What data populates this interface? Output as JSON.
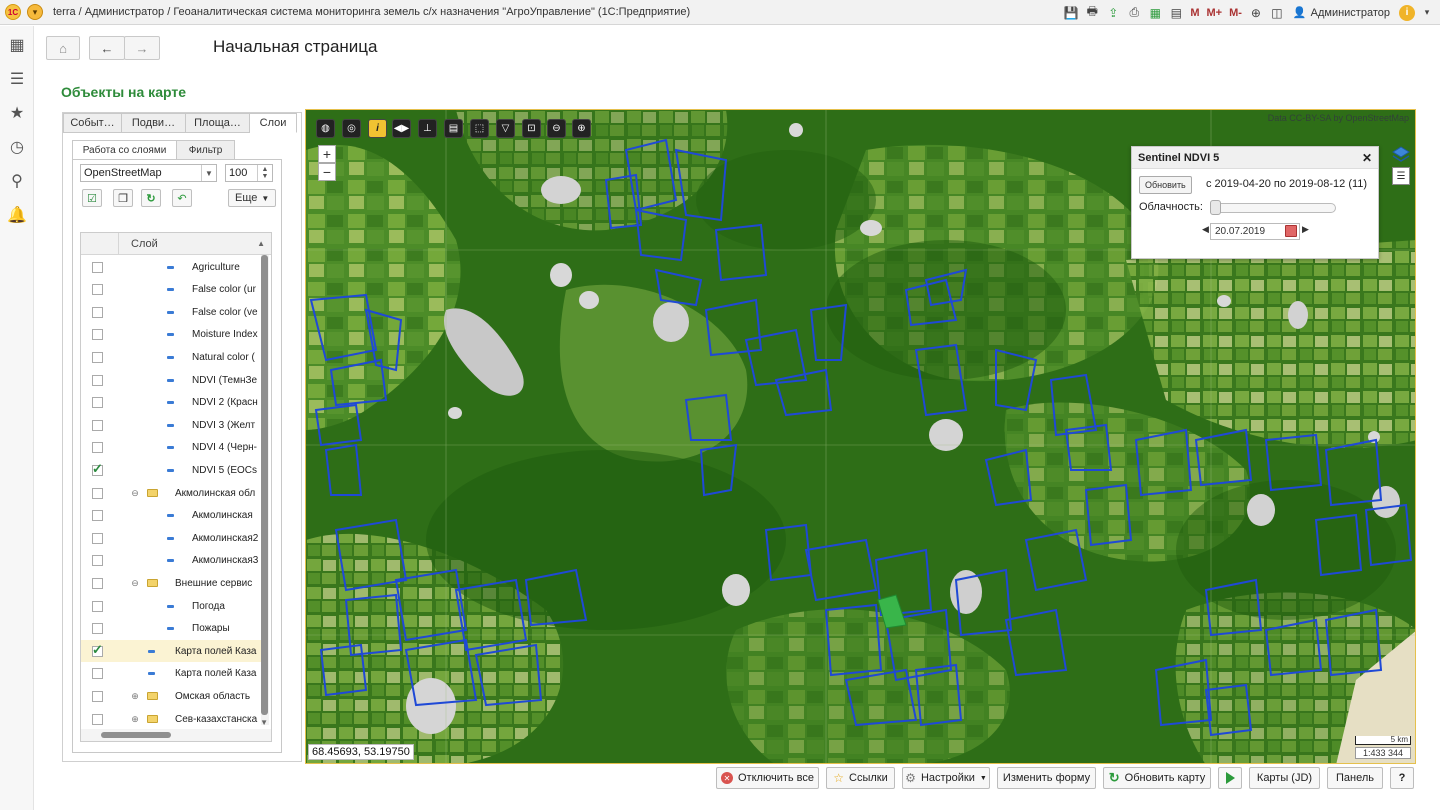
{
  "window": {
    "title": "terra / Администратор / Геоаналитическая система мониторинга земель с/х назначения \"АгроУправление\"  (1С:Предприятие)",
    "user": "Администратор",
    "toolbar_text": [
      "M",
      "M+",
      "M-"
    ]
  },
  "header": {
    "page_title": "Начальная страница",
    "section_title": "Объекты на карте"
  },
  "left_panel": {
    "tabs": [
      "Событ…",
      "Подви…",
      "Площа…",
      "Слои"
    ],
    "inner_tabs": [
      "Работа со слоями",
      "Фильтр"
    ],
    "basemap": "OpenStreetMap",
    "opacity": "100",
    "more_label": "Еще",
    "column_header": "Слой",
    "layers": [
      {
        "label": "Agriculture",
        "type": "layer",
        "checked": false,
        "level": 2
      },
      {
        "label": "False color (ur",
        "type": "layer",
        "checked": false,
        "level": 2
      },
      {
        "label": "False color (ve",
        "type": "layer",
        "checked": false,
        "level": 2
      },
      {
        "label": "Moisture Index",
        "type": "layer",
        "checked": false,
        "level": 2
      },
      {
        "label": "Natural color (",
        "type": "layer",
        "checked": false,
        "level": 2
      },
      {
        "label": "NDVI (ТемнЗе",
        "type": "layer",
        "checked": false,
        "level": 2
      },
      {
        "label": "NDVI 2 (Красн",
        "type": "layer",
        "checked": false,
        "level": 2
      },
      {
        "label": "NDVI 3 (Желт",
        "type": "layer",
        "checked": false,
        "level": 2
      },
      {
        "label": "NDVI 4 (Черн-",
        "type": "layer",
        "checked": false,
        "level": 2
      },
      {
        "label": "NDVI 5 (EOCs",
        "type": "layer",
        "checked": true,
        "level": 2
      },
      {
        "label": "Акмолинская обл",
        "type": "folder",
        "checked": false,
        "level": 1,
        "expanded": true
      },
      {
        "label": "Акмолинская",
        "type": "layer",
        "checked": false,
        "level": 2
      },
      {
        "label": "Акмолинская2",
        "type": "layer",
        "checked": false,
        "level": 2
      },
      {
        "label": "Акмолинская3",
        "type": "layer",
        "checked": false,
        "level": 2
      },
      {
        "label": "Внешние сервис",
        "type": "folder",
        "checked": false,
        "level": 1,
        "expanded": true
      },
      {
        "label": "Погода",
        "type": "layer",
        "checked": false,
        "level": 2
      },
      {
        "label": "Пожары",
        "type": "layer",
        "checked": false,
        "level": 2
      },
      {
        "label": "Карта полей Каза",
        "type": "layer",
        "checked": true,
        "level": 1,
        "selected": true
      },
      {
        "label": "Карта полей Каза",
        "type": "layer",
        "checked": false,
        "level": 1
      },
      {
        "label": "Омская область",
        "type": "folder",
        "checked": false,
        "level": 1,
        "expanded": false
      },
      {
        "label": "Сев-казахстанска",
        "type": "folder",
        "checked": false,
        "level": 1,
        "expanded": false
      }
    ]
  },
  "map": {
    "attribution": "Data CC-BY-SA by OpenStreetMap",
    "coords": "68.45693, 53.19750",
    "scale_label": "5 km",
    "scale_ratio": "1:433 344",
    "colors": {
      "forest": "#2e6e17",
      "field_outline": "#1f49d6",
      "selected_field": "#39b54a"
    }
  },
  "sentinel": {
    "title": "Sentinel NDVI 5",
    "update_label": "Обновить",
    "period": "с 2019-04-20 по 2019-08-12 (11)",
    "cloud_label": "Облачность:",
    "date": "20.07.2019"
  },
  "commands": {
    "disable_all": "Отключить все",
    "links": "Ссылки",
    "settings": "Настройки",
    "change_form": "Изменить форму",
    "refresh_map": "Обновить карту",
    "maps_jd": "Карты (JD)",
    "panel": "Панель",
    "help": "?"
  }
}
